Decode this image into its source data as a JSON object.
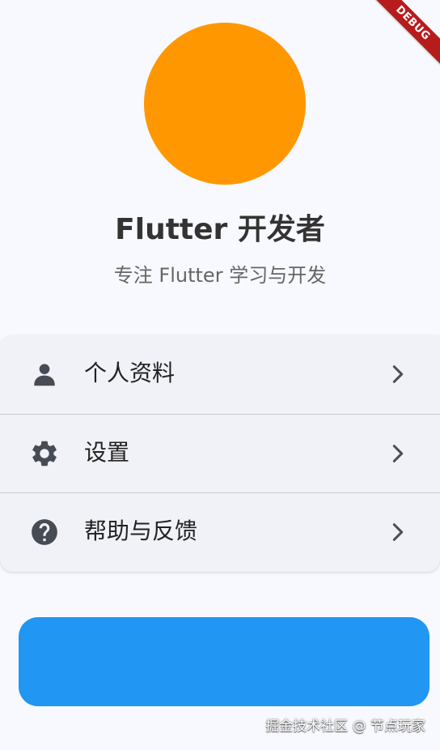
{
  "debug_banner": {
    "label": "DEBUG"
  },
  "profile": {
    "avatar_color": "#ff9800",
    "name": "Flutter 开发者",
    "subtitle": "专注 Flutter 学习与开发"
  },
  "menu": {
    "items": [
      {
        "icon": "person-icon",
        "label": "个人资料"
      },
      {
        "icon": "gear-icon",
        "label": "设置"
      },
      {
        "icon": "help-icon",
        "label": "帮助与反馈"
      }
    ]
  },
  "primary_button": {
    "label": "",
    "color": "#2196f3"
  },
  "watermark": {
    "text": "掘金技术社区 @ 节点玩家"
  }
}
